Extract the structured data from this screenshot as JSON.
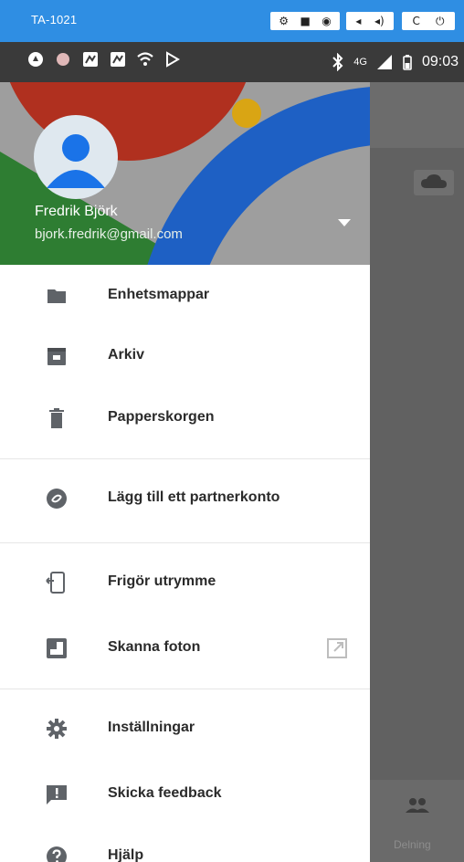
{
  "emulator": {
    "title": "TA-1021",
    "controls_group1": [
      "⚙",
      "■",
      "◉"
    ],
    "controls_group2": [
      "◂",
      "◂)"
    ],
    "controls_group3": [
      "C",
      "⏻"
    ]
  },
  "status_bar": {
    "left_icons": [
      "sync-icon",
      "dot-icon",
      "image-icon",
      "image-icon",
      "wifi-icon",
      "play-icon"
    ],
    "network": "4G",
    "time": "09:03"
  },
  "account": {
    "name": "Fredrik Björk",
    "email": "bjork.fredrik@gmail.com"
  },
  "menu": {
    "group1": [
      {
        "label": "Enhetsmappar",
        "icon": "folder-icon"
      },
      {
        "label": "Arkiv",
        "icon": "archive-icon"
      },
      {
        "label": "Papperskorgen",
        "icon": "trash-icon"
      }
    ],
    "group2": [
      {
        "label": "Lägg till ett partnerkonto",
        "icon": "partner-icon"
      }
    ],
    "group3": [
      {
        "label": "Frigör utrymme",
        "icon": "free-space-icon"
      },
      {
        "label": "Skanna foton",
        "icon": "photoscan-icon",
        "external": true
      }
    ],
    "group4": [
      {
        "label": "Inställningar",
        "icon": "settings-icon"
      },
      {
        "label": "Skicka feedback",
        "icon": "feedback-icon"
      },
      {
        "label": "Hjälp",
        "icon": "help-icon"
      }
    ]
  },
  "background_app": {
    "bottom_tab_label": "Delning"
  },
  "colors": {
    "emulator_bar": "#2f8ee3",
    "header_red": "#b0301f",
    "header_green": "#2e7d32",
    "header_blue": "#1e60c4",
    "header_yellow": "#d9a514",
    "icon_gray": "#5f6368"
  }
}
